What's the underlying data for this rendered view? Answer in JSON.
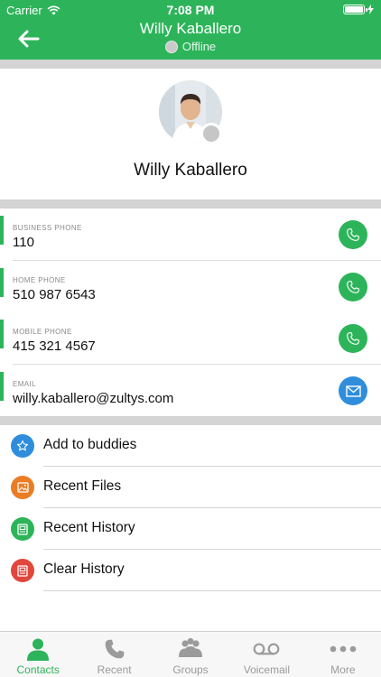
{
  "status_bar": {
    "carrier": "Carrier",
    "time": "7:08 PM"
  },
  "header": {
    "back_icon": "arrow-left-icon",
    "title": "Willy Kaballero",
    "status": "Offline"
  },
  "profile": {
    "name": "Willy Kaballero",
    "presence": "offline"
  },
  "fields": [
    {
      "label": "BUSINESS PHONE",
      "value": "110",
      "action_icon": "phone-icon",
      "action_color": "#2db45a"
    },
    {
      "label": "HOME PHONE",
      "value": "510 987 6543",
      "action_icon": "phone-icon",
      "action_color": "#2db45a"
    },
    {
      "label": "MOBILE PHONE",
      "value": "415 321 4567",
      "action_icon": "phone-icon",
      "action_color": "#2db45a"
    },
    {
      "label": "EMAIL",
      "value": "willy.kaballero@zultys.com",
      "action_icon": "envelope-icon",
      "action_color": "#2f8ddc"
    }
  ],
  "actions": [
    {
      "label": "Add to buddies",
      "icon": "star-icon",
      "color": "#2f8ddc"
    },
    {
      "label": "Recent Files",
      "icon": "image-icon",
      "color": "#ea7d24"
    },
    {
      "label": "Recent History",
      "icon": "history-icon",
      "color": "#2db45a"
    },
    {
      "label": "Clear History",
      "icon": "trash-icon",
      "color": "#e0473d"
    }
  ],
  "tabs": [
    {
      "label": "Contacts",
      "icon": "person-icon",
      "active": true
    },
    {
      "label": "Recent",
      "icon": "phone-icon",
      "active": false
    },
    {
      "label": "Groups",
      "icon": "group-icon",
      "active": false
    },
    {
      "label": "Voicemail",
      "icon": "voicemail-icon",
      "active": false
    },
    {
      "label": "More",
      "icon": "more-icon",
      "active": false
    }
  ],
  "colors": {
    "accent": "#2db45a",
    "email": "#2f8ddc",
    "offline": "#c6c6c6"
  }
}
